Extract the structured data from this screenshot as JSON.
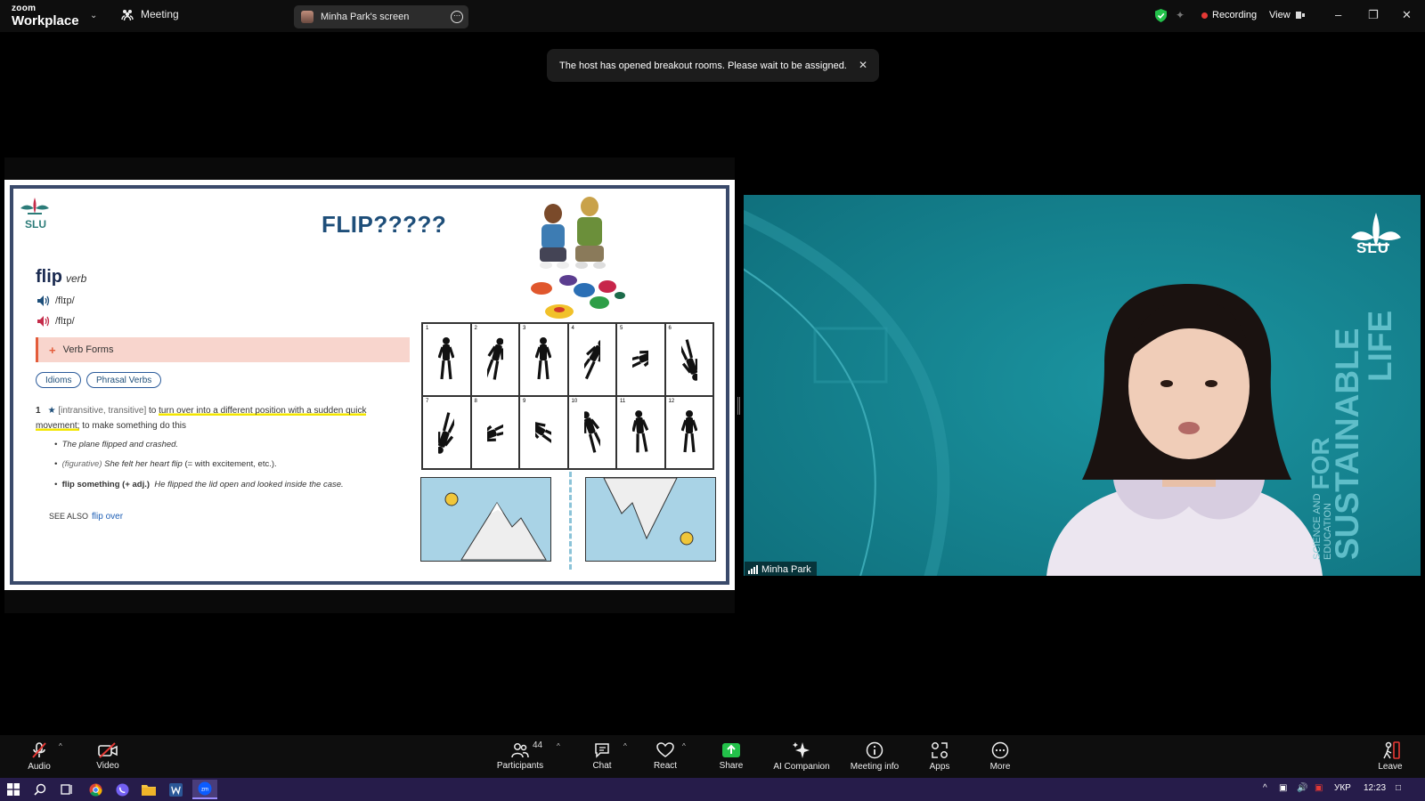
{
  "app": {
    "brand_top": "zoom",
    "brand_bottom": "Workplace",
    "meeting_label": "Meeting"
  },
  "share_pill": {
    "label": "Minha Park's screen"
  },
  "top_right": {
    "recording": "Recording",
    "view": "View"
  },
  "toast": {
    "message": "The host has opened breakout rooms. Please wait to be assigned."
  },
  "slide": {
    "logo_text": "SLU",
    "title": "FLIP?????",
    "word": "flip",
    "pos": "verb",
    "pron_uk": "/flɪp/",
    "pron_us": "/flɪp/",
    "verb_forms": "Verb Forms",
    "chip_idioms": "Idioms",
    "chip_phrasal": "Phrasal Verbs",
    "def_num": "1",
    "def_gram": "[intransitive, transitive]",
    "def_text_pre": "to ",
    "def_text_hl": "turn over into a different position with a sudden quick movement;",
    "def_text_post": " to make something do this",
    "ex1": "The plane flipped and crashed.",
    "ex2_tag": "(figurative)",
    "ex2": "She felt her heart flip",
    "ex2_tail": "(= with excitement, etc.).",
    "ex3_bold": "flip something (+ adj.)",
    "ex3": "He flipped the lid open and looked inside the case.",
    "see_also": "SEE ALSO",
    "see_also_link": "flip over",
    "grid_numbers": [
      "1",
      "2",
      "3",
      "4",
      "5",
      "6",
      "7",
      "8",
      "9",
      "10",
      "11",
      "12"
    ]
  },
  "video": {
    "participant_name": "Minha Park",
    "bg_logo": "SLU",
    "bg_small_1": "SCIENCE AND",
    "bg_small_2": "EDUCATION",
    "bg_for": "FOR",
    "bg_big_1": "SUSTAINABLE",
    "bg_big_2": "LIFE"
  },
  "toolbar": {
    "audio": "Audio",
    "video": "Video",
    "participants": "Participants",
    "participants_count": "44",
    "chat": "Chat",
    "react": "React",
    "share": "Share",
    "ai": "AI Companion",
    "info": "Meeting info",
    "apps": "Apps",
    "more": "More",
    "leave": "Leave"
  },
  "taskbar": {
    "lang": "УКР",
    "time": "12:23"
  },
  "colors": {
    "accent_green": "#23c14a",
    "record_red": "#e53935",
    "taskbar": "#261c4a",
    "slide_title": "#1e4e79",
    "video_bg": "#16828f"
  }
}
